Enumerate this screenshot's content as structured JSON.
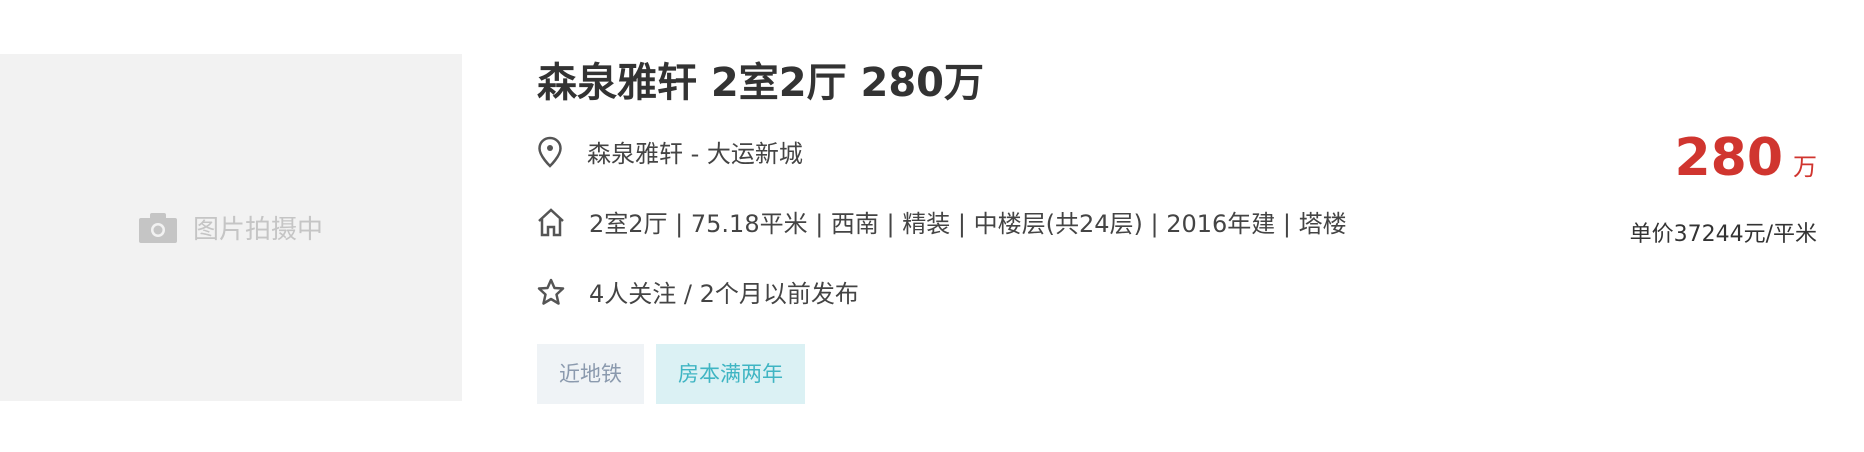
{
  "image_placeholder": {
    "text": "图片拍摄中",
    "icon": "camera-icon"
  },
  "title": "森泉雅轩 2室2厅 280万",
  "location": {
    "icon": "location-pin-icon",
    "text": "森泉雅轩 - 大运新城"
  },
  "house_info": {
    "icon": "house-icon",
    "text": "2室2厅 | 75.18平米 | 西南 | 精装 | 中楼层(共24层) | 2016年建 | 塔楼"
  },
  "follow_info": {
    "icon": "star-icon",
    "text": "4人关注 / 2个月以前发布"
  },
  "tags": [
    "近地铁",
    "房本满两年"
  ],
  "price": {
    "total": "280",
    "unit": "万",
    "unit_price": "单价37244元/平米",
    "color": "#d0352f"
  }
}
